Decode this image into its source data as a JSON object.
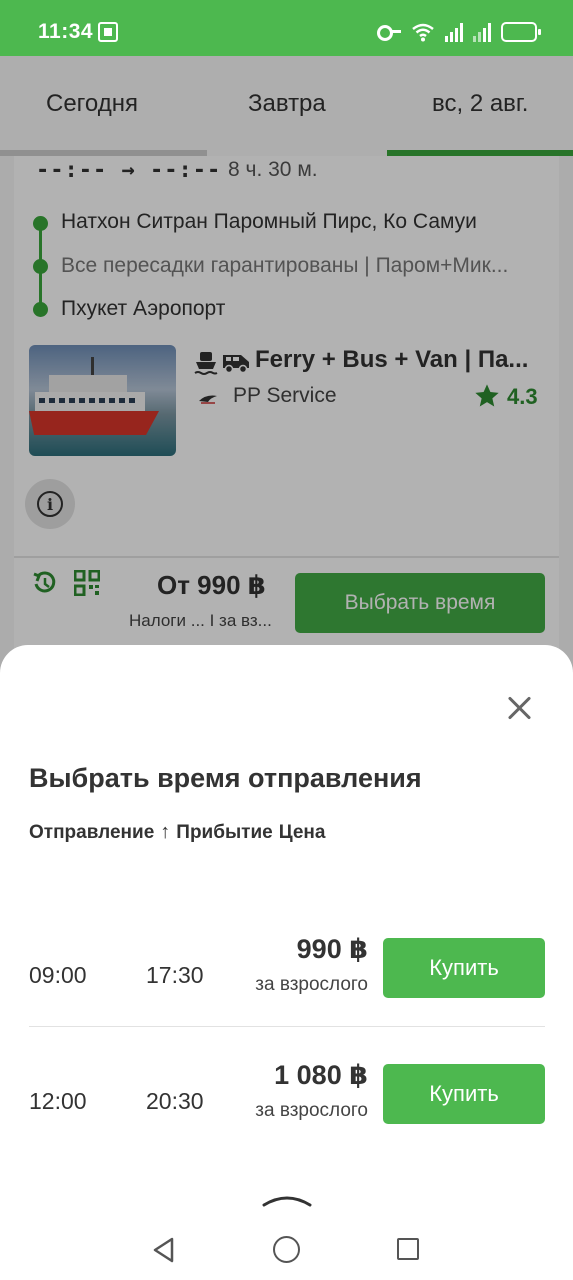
{
  "status_bar": {
    "time": "11:34"
  },
  "tabs": [
    {
      "label": "Сегодня"
    },
    {
      "label": "Завтра"
    },
    {
      "label": "вс, 2 авг."
    }
  ],
  "card": {
    "times": "--:-- → --:--",
    "duration": "8 ч. 30 м.",
    "route": {
      "from": "Натхон Ситран Паромный Пирс, Ко Самуи",
      "via": "Все пересадки гарантированы | Паром+Мик...",
      "to": "Пхукет Аэропорт"
    },
    "transport_title": "Ferry + Bus + Van | Па...",
    "operator": "PP Service",
    "rating": "4.3",
    "info_label": "i",
    "price_from": "От 990 ฿",
    "price_note": "Налоги ... I за вз...",
    "choose_time_label": "Выбрать время"
  },
  "sheet": {
    "title": "Выбрать время отправления",
    "sort": {
      "departure": "Отправление",
      "arrow": "↑",
      "arrival": "Прибытие",
      "price": "Цена"
    },
    "trips": [
      {
        "departure": "09:00",
        "arrival": "17:30",
        "price": "990 ฿",
        "per": "за взрослого",
        "buy_label": "Купить"
      },
      {
        "departure": "12:00",
        "arrival": "20:30",
        "price": "1 080 ฿",
        "per": "за взрослого",
        "buy_label": "Купить"
      }
    ]
  },
  "icons": {
    "status": [
      "key-icon",
      "wifi-icon",
      "signal-icon",
      "signal-icon",
      "battery-icon"
    ],
    "transport": [
      "ferry-icon",
      "van-icon"
    ],
    "footer": [
      "refund-icon",
      "qr-code-icon"
    ]
  },
  "colors": {
    "brand_green": "#4db84f",
    "dark_green": "#3aa63c",
    "rating_green": "#2e8b31"
  }
}
